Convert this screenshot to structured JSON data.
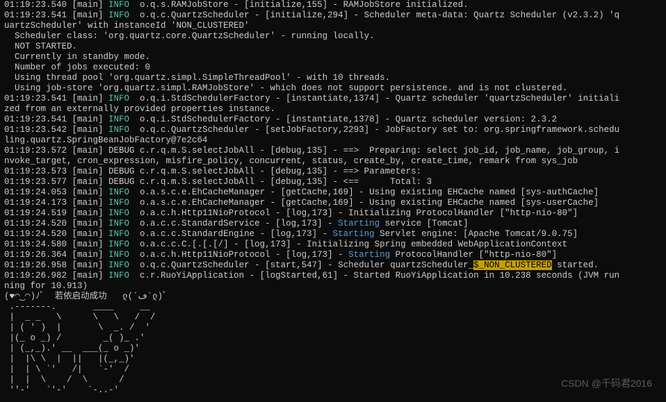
{
  "lines": [
    {
      "segments": [
        {
          "t": "01:19:23.540 [main] "
        },
        {
          "t": "INFO",
          "c": "info"
        },
        {
          "t": "  o.q.s.RAMJobStore - [initialize,155] - RAMJobStore initialized."
        }
      ]
    },
    {
      "segments": [
        {
          "t": "01:19:23.541 [main] "
        },
        {
          "t": "INFO",
          "c": "info"
        },
        {
          "t": "  o.q.c.QuartzScheduler - [initialize,294] - Scheduler meta-data: Quartz Scheduler (v2.3.2) 'q"
        }
      ]
    },
    {
      "segments": [
        {
          "t": "uartzScheduler' with instanceId 'NON_CLUSTERED'"
        }
      ]
    },
    {
      "segments": [
        {
          "t": "  Scheduler class: 'org.quartz.core.QuartzScheduler' - running locally."
        }
      ]
    },
    {
      "segments": [
        {
          "t": "  NOT STARTED."
        }
      ]
    },
    {
      "segments": [
        {
          "t": "  Currently in standby mode."
        }
      ]
    },
    {
      "segments": [
        {
          "t": "  Number of jobs executed: 0"
        }
      ]
    },
    {
      "segments": [
        {
          "t": "  Using thread pool 'org.quartz.simpl.SimpleThreadPool' - with 10 threads."
        }
      ]
    },
    {
      "segments": [
        {
          "t": "  Using job-store 'org.quartz.simpl.RAMJobStore' - which does not support persistence. and is not clustered."
        }
      ]
    },
    {
      "segments": [
        {
          "t": ""
        }
      ]
    },
    {
      "segments": [
        {
          "t": "01:19:23.541 [main] "
        },
        {
          "t": "INFO",
          "c": "info"
        },
        {
          "t": "  o.q.i.StdSchedulerFactory - [instantiate,1374] - Quartz scheduler 'quartzScheduler' initiali"
        }
      ]
    },
    {
      "segments": [
        {
          "t": "zed from an externally provided properties instance."
        }
      ]
    },
    {
      "segments": [
        {
          "t": "01:19:23.541 [main] "
        },
        {
          "t": "INFO",
          "c": "info"
        },
        {
          "t": "  o.q.i.StdSchedulerFactory - [instantiate,1378] - Quartz scheduler version: 2.3.2"
        }
      ]
    },
    {
      "segments": [
        {
          "t": "01:19:23.542 [main] "
        },
        {
          "t": "INFO",
          "c": "info"
        },
        {
          "t": "  o.q.c.QuartzScheduler - [setJobFactory,2293] - JobFactory set to: org.springframework.schedu"
        }
      ]
    },
    {
      "segments": [
        {
          "t": "ling.quartz.SpringBeanJobFactory@7e2c64"
        }
      ]
    },
    {
      "segments": [
        {
          "t": "01:19:23.572 [main] DEBUG c.r.q.m.S.selectJobAll - [debug,135] - ==>  Preparing: select job_id, job_name, job_group, i"
        }
      ]
    },
    {
      "segments": [
        {
          "t": "nvoke_target, cron_expression, misfire_policy, concurrent, status, create_by, create_time, remark from sys_job"
        }
      ]
    },
    {
      "segments": [
        {
          "t": "01:19:23.573 [main] DEBUG c.r.q.m.S.selectJobAll - [debug,135] - ==> Parameters:"
        }
      ]
    },
    {
      "segments": [
        {
          "t": "01:19:23.577 [main] DEBUG c.r.q.m.S.selectJobAll - [debug,135] - <==      Total: 3"
        }
      ]
    },
    {
      "segments": [
        {
          "t": "01:19:24.053 [main] "
        },
        {
          "t": "INFO",
          "c": "info"
        },
        {
          "t": "  o.a.s.c.e.EhCacheManager - [getCache,169] - Using existing EHCache named [sys-authCache]"
        }
      ]
    },
    {
      "segments": [
        {
          "t": "01:19:24.173 [main] "
        },
        {
          "t": "INFO",
          "c": "info"
        },
        {
          "t": "  o.a.s.c.e.EhCacheManager - [getCache,169] - Using existing EHCache named [sys-userCache]"
        }
      ]
    },
    {
      "segments": [
        {
          "t": "01:19:24.519 [main] "
        },
        {
          "t": "INFO",
          "c": "info"
        },
        {
          "t": "  o.a.c.h.Http11NioProtocol - [log,173] - Initializing ProtocolHandler [\"http-nio-80\"]"
        }
      ]
    },
    {
      "segments": [
        {
          "t": "01:19:24.520 [main] "
        },
        {
          "t": "INFO",
          "c": "info"
        },
        {
          "t": "  o.a.c.c.StandardService - [log,173] - "
        },
        {
          "t": "Starting",
          "c": "start"
        },
        {
          "t": " service [Tomcat]"
        }
      ]
    },
    {
      "segments": [
        {
          "t": "01:19:24.520 [main] "
        },
        {
          "t": "INFO",
          "c": "info"
        },
        {
          "t": "  o.a.c.c.StandardEngine - [log,173] - "
        },
        {
          "t": "Starting",
          "c": "start"
        },
        {
          "t": " Servlet engine: [Apache Tomcat/9.0.75]"
        }
      ]
    },
    {
      "segments": [
        {
          "t": "01:19:24.580 [main] "
        },
        {
          "t": "INFO",
          "c": "info"
        },
        {
          "t": "  o.a.c.c.C.[.[.[/] - [log,173] - Initializing Spring embedded WebApplicationContext"
        }
      ]
    },
    {
      "segments": [
        {
          "t": "01:19:26.364 [main] "
        },
        {
          "t": "INFO",
          "c": "info"
        },
        {
          "t": "  o.a.c.h.Http11NioProtocol - [log,173] - "
        },
        {
          "t": "Starting",
          "c": "start"
        },
        {
          "t": " ProtocolHandler [\"http-nio-80\"]"
        }
      ]
    },
    {
      "segments": [
        {
          "t": "01:19:26.958 [main] "
        },
        {
          "t": "INFO",
          "c": "info"
        },
        {
          "t": "  o.q.c.QuartzScheduler - [start,547] - Scheduler quartzScheduler_"
        },
        {
          "t": "$_NON_CLUSTERED",
          "c": "highlight"
        },
        {
          "t": " started."
        }
      ]
    },
    {
      "segments": [
        {
          "t": "01:19:26.982 [main] "
        },
        {
          "t": "INFO",
          "c": "info"
        },
        {
          "t": "  c.r.RuoYiApplication - [logStarted,61] - Started RuoYiApplication in 10.238 seconds (JVM run"
        }
      ]
    },
    {
      "segments": [
        {
          "t": "ning for 10.913)"
        }
      ]
    },
    {
      "segments": [
        {
          "t": "(♥◠‿◠)ﾉﾞ  若依启动成功   ლ(´ڡ`ლ)ﾞ"
        }
      ]
    },
    {
      "segments": [
        {
          "t": " .-------.       ____     __"
        }
      ]
    },
    {
      "segments": [
        {
          "t": " |  _ _   \\      \\   \\   /  /"
        }
      ]
    },
    {
      "segments": [
        {
          "t": " | ( ' )  |       \\  _. /  '"
        }
      ]
    },
    {
      "segments": [
        {
          "t": " |(_ o _) /        _( )_ .'"
        }
      ]
    },
    {
      "segments": [
        {
          "t": " | (_,_).' __  ___(_ o _)'"
        }
      ]
    },
    {
      "segments": [
        {
          "t": " |  |\\ \\  |  ||   |(_,_)'"
        }
      ]
    },
    {
      "segments": [
        {
          "t": " |  | \\ `'   /|   `-'  /"
        }
      ]
    },
    {
      "segments": [
        {
          "t": " |  |  \\    /  \\      /"
        }
      ]
    },
    {
      "segments": [
        {
          "t": " ''-'   `'-'    `-..-'"
        }
      ]
    }
  ],
  "watermark": "CSDN @千码君2016"
}
